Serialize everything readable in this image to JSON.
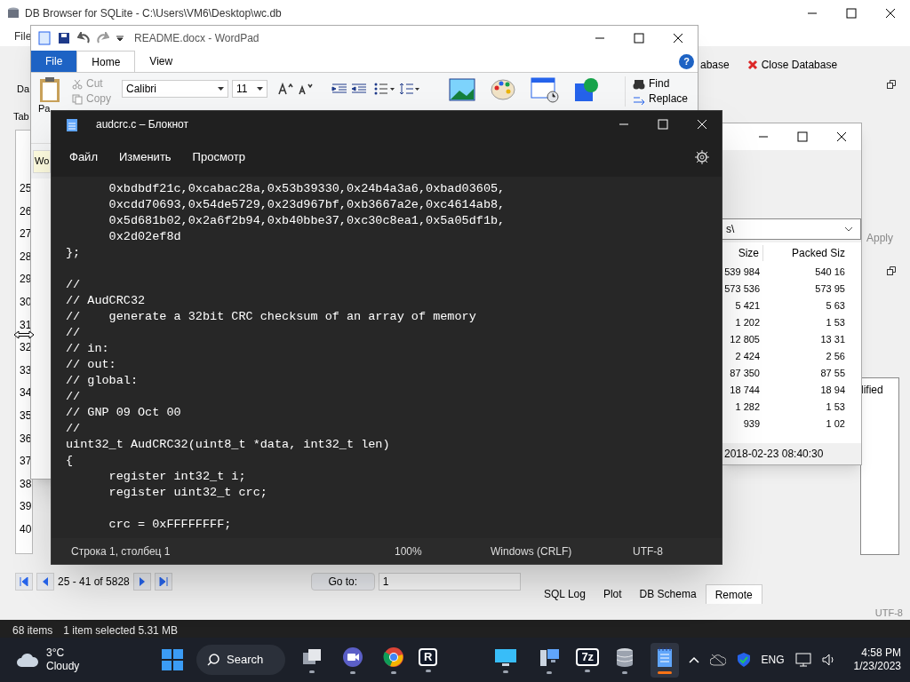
{
  "db_browser": {
    "title": "DB Browser for SQLite - C:\\Users\\VM6\\Desktop\\wc.db",
    "menu": [
      "File"
    ],
    "toolbar": [
      "abase",
      "Close Database"
    ],
    "side_tabs": [
      "Da",
      "Tab"
    ],
    "row_numbers": [
      "25",
      "26",
      "27",
      "28",
      "29",
      "30",
      "31",
      "32",
      "33",
      "34",
      "35",
      "36",
      "37",
      "38",
      "39",
      "40"
    ],
    "pager": {
      "range": "25 - 41 of 5828",
      "goto_label": "Go to:",
      "goto_value": "1"
    },
    "dock_tabs": [
      {
        "label": "SQL Log",
        "selected": false
      },
      {
        "label": "Plot",
        "selected": false
      },
      {
        "label": "DB Schema",
        "selected": false
      },
      {
        "label": "Remote",
        "selected": true
      }
    ],
    "apply": "Apply",
    "partial_label": "lified",
    "encoding": "UTF-8"
  },
  "explorer_status": [
    "68 items",
    "1 item selected  5.31 MB"
  ],
  "archive": {
    "path": "s\\",
    "columns": [
      "Size",
      "Packed Siz"
    ],
    "rows": [
      [
        "539 984",
        "540 16"
      ],
      [
        "573 536",
        "573 95"
      ],
      [
        "5 421",
        "5 63"
      ],
      [
        "1 202",
        "1 53"
      ],
      [
        "12 805",
        "13 31"
      ],
      [
        "2 424",
        "2 56"
      ],
      [
        "87 350",
        "87 55"
      ],
      [
        "18 744",
        "18 94"
      ],
      [
        "1 282",
        "1 53"
      ],
      [
        "939",
        "1 02"
      ]
    ],
    "modified": "2018-02-23 08:40:30"
  },
  "wordpad": {
    "title": "README.docx - WordPad",
    "tabs": [
      {
        "label": "File",
        "kind": "menu",
        "selected": false
      },
      {
        "label": "Home",
        "kind": "tab",
        "selected": true
      },
      {
        "label": "View",
        "kind": "tab",
        "selected": false
      }
    ],
    "help": "?",
    "clipboard": {
      "paste": "Pa",
      "cut": "Cut",
      "copy": "Copy"
    },
    "font": "Calibri",
    "size": "11",
    "editing": [
      "Find",
      "Replace"
    ],
    "doc_tab": "Wo"
  },
  "notepad": {
    "title": "audcrc.c – Блокнот",
    "menu": [
      "Файл",
      "Изменить",
      "Просмотр"
    ],
    "lines": [
      {
        "text": "      0xbdbdf21c,0xcabac28a,0x53b39330,0x24b4a3a6,0xbad03605,",
        "gap_before": false
      },
      {
        "text": "      0xcdd70693,0x54de5729,0x23d967bf,0xb3667a2e,0xc4614ab8,",
        "gap_before": false
      },
      {
        "text": "      0x5d681b02,0x2a6f2b94,0xb40bbe37,0xc30c8ea1,0x5a05df1b,",
        "gap_before": false
      },
      {
        "text": "      0x2d02ef8d",
        "gap_before": false
      },
      {
        "text": "};",
        "gap_before": false
      },
      {
        "text": "//",
        "gap_before": true
      },
      {
        "text": "// AudCRC32",
        "gap_before": false
      },
      {
        "text": "//    generate a 32bit CRC checksum of an array of memory",
        "gap_before": false
      },
      {
        "text": "//",
        "gap_before": false
      },
      {
        "text": "// in:",
        "gap_before": false
      },
      {
        "text": "// out:",
        "gap_before": false
      },
      {
        "text": "// global:",
        "gap_before": false
      },
      {
        "text": "//",
        "gap_before": false
      },
      {
        "text": "// GNP 09 Oct 00",
        "gap_before": false
      },
      {
        "text": "//",
        "gap_before": false
      },
      {
        "text": "uint32_t AudCRC32(uint8_t *data, int32_t len)",
        "gap_before": false
      },
      {
        "text": "{",
        "gap_before": false
      },
      {
        "text": "      register int32_t i;",
        "gap_before": false
      },
      {
        "text": "      register uint32_t crc;",
        "gap_before": false
      },
      {
        "text": "      crc = 0xFFFFFFFF;",
        "gap_before": true
      }
    ],
    "status": [
      "Строка 1, столбец 1",
      "100%",
      "Windows (CRLF)",
      "UTF-8"
    ]
  },
  "taskbar": {
    "weather": {
      "temp": "3°C",
      "condition": "Cloudy"
    },
    "search": "Search",
    "apps": [
      {
        "kind": "taskview",
        "active": false
      },
      {
        "kind": "video",
        "active": false
      },
      {
        "kind": "browser",
        "active": false
      },
      {
        "kind": "letter",
        "glyph": "R",
        "active": false
      },
      {
        "kind": "monitor",
        "active": false
      },
      {
        "kind": "computer",
        "active": false
      },
      {
        "kind": "letter",
        "glyph": "7z",
        "active": false
      },
      {
        "kind": "database",
        "active": false
      },
      {
        "kind": "notepad",
        "active": true
      }
    ],
    "language": "ENG",
    "time": "4:58 PM",
    "date": "1/23/2023"
  }
}
